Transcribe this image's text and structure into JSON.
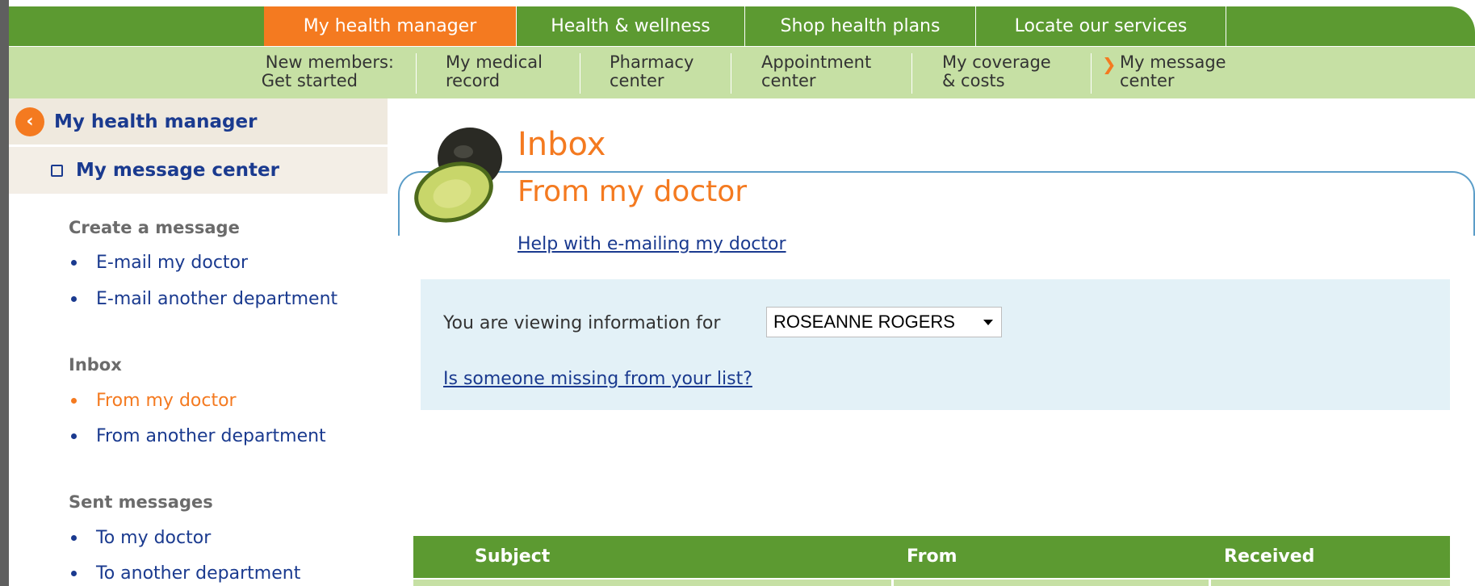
{
  "topnav": {
    "tabs": [
      {
        "label": "My health manager",
        "active": true
      },
      {
        "label": "Health & wellness",
        "active": false
      },
      {
        "label": "Shop health plans",
        "active": false
      },
      {
        "label": "Locate our services",
        "active": false
      }
    ]
  },
  "subnav": {
    "items": [
      {
        "line1": "New members:",
        "line2": "Get started"
      },
      {
        "line1": "My medical",
        "line2": "record"
      },
      {
        "line1": "Pharmacy",
        "line2": "center"
      },
      {
        "line1": "Appointment",
        "line2": "center"
      },
      {
        "line1": "My coverage",
        "line2": "& costs"
      },
      {
        "line1": "My message",
        "line2": "center",
        "current": true
      }
    ]
  },
  "sidebar": {
    "header": "My health manager",
    "section": "My message center",
    "groups": [
      {
        "title": "Create a message",
        "links": [
          {
            "label": "E-mail my doctor"
          },
          {
            "label": "E-mail another department"
          }
        ]
      },
      {
        "title": "Inbox",
        "links": [
          {
            "label": "From my doctor",
            "active": true
          },
          {
            "label": "From another department"
          }
        ]
      },
      {
        "title": "Sent messages",
        "links": [
          {
            "label": "To my doctor"
          },
          {
            "label": "To another department"
          }
        ]
      }
    ]
  },
  "main": {
    "title": "Inbox",
    "subtitle": "From my doctor",
    "help_link": "Help with e-mailing my doctor",
    "viewer": {
      "label": "You are viewing information for",
      "selected": "ROSEANNE ROGERS",
      "missing_link": "Is someone missing from your list?"
    },
    "table": {
      "columns": [
        "Subject",
        "From",
        "Received"
      ]
    }
  },
  "colors": {
    "primary_green": "#5c9a31",
    "light_green": "#c6e0a4",
    "accent_orange": "#f47a20",
    "link_blue": "#1a3a8f",
    "info_box": "#e3f1f7"
  },
  "icons": {
    "back": "chevron-left-icon",
    "section": "square-bullet-icon",
    "current_arrow": "chevron-right-icon",
    "dropdown": "caret-down-icon",
    "image": "avocado-image"
  }
}
